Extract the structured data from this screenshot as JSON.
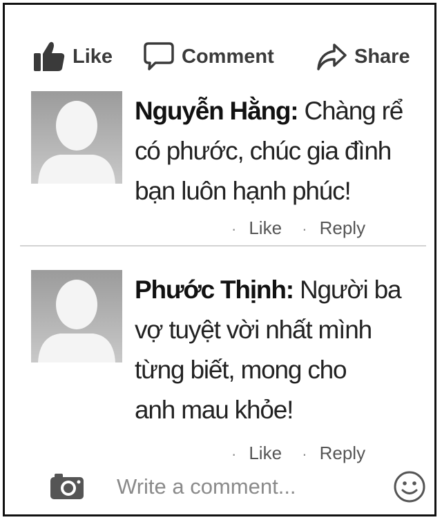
{
  "actions": {
    "like_label": "Like",
    "comment_label": "Comment",
    "share_label": "Share"
  },
  "comments": [
    {
      "author": "Nguyễn Hằng:",
      "lines": [
        "Chàng rể",
        "có phước, chúc gia đình",
        "bạn luôn hạnh phúc!"
      ],
      "like_label": "Like",
      "reply_label": "Reply"
    },
    {
      "author": "Phước Thịnh:",
      "lines": [
        "Người ba",
        "vợ tuyệt vời nhất mình",
        "từng biết, mong cho",
        "anh mau khỏe!"
      ],
      "like_label": "Like",
      "reply_label": "Reply"
    }
  ],
  "composer": {
    "placeholder": "Write a comment...",
    "value": ""
  },
  "icons": {
    "like": "thumbs-up-icon",
    "comment": "speech-bubble-icon",
    "share": "share-arrow-icon",
    "camera": "camera-icon",
    "emoji": "smiley-icon"
  },
  "colors": {
    "icon": "#3a3a3a",
    "avatar_bg": "#b4b4b4",
    "divider": "#d2d2d2",
    "border": "#111111"
  }
}
